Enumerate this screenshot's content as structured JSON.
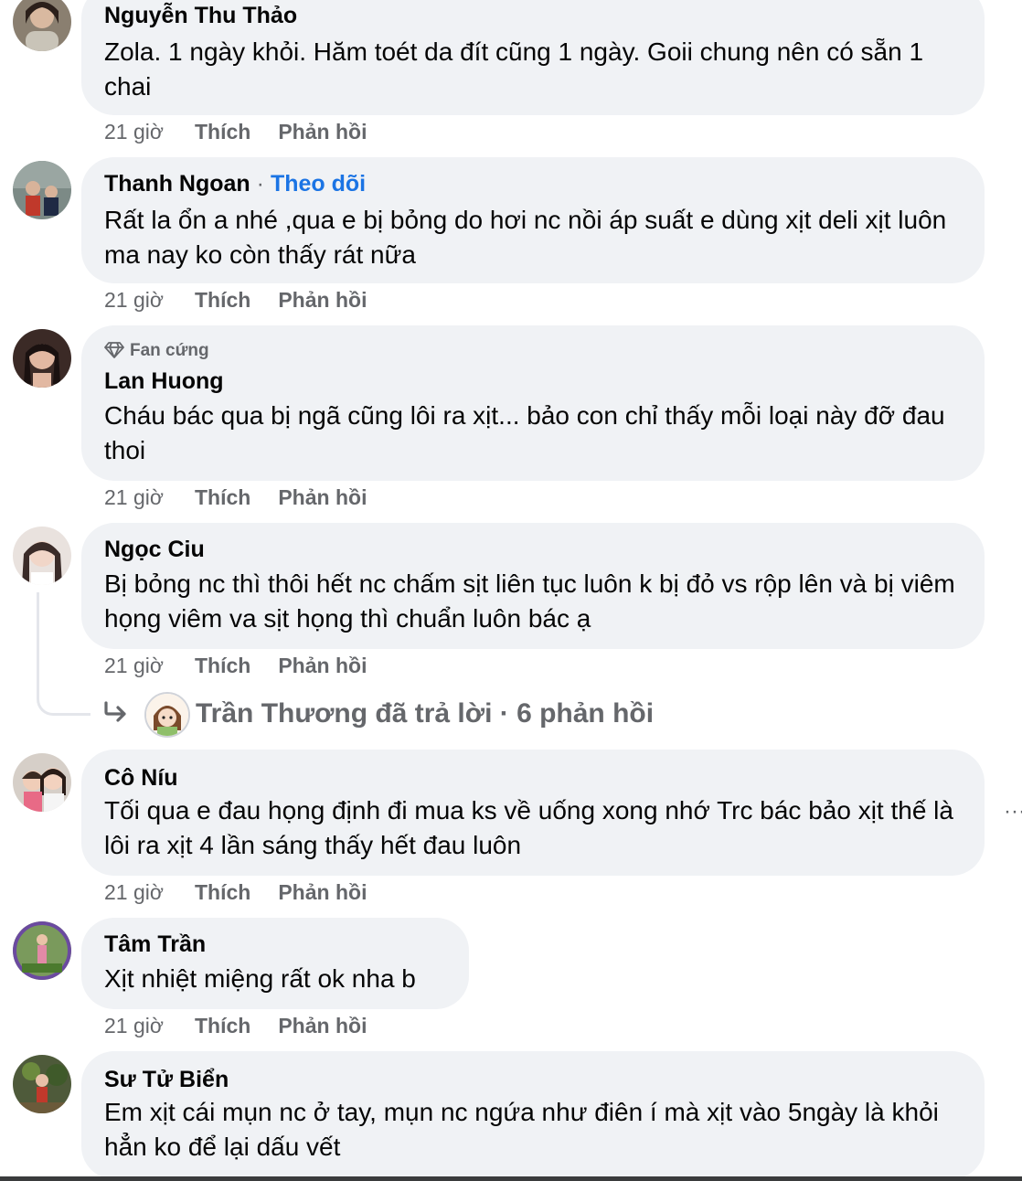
{
  "comments": [
    {
      "author": "Nguyễn Thu Thảo",
      "text": "Zola. 1 ngày khỏi. Hăm toét da đít cũng 1 ngày. Goii chung nên có sẵn 1 chai",
      "time": "21 giờ",
      "like_label": "Thích",
      "reply_label": "Phản hồi"
    },
    {
      "author": "Thanh Ngoan",
      "separator": "·",
      "follow_label": "Theo dõi",
      "text": "Rất la ổn a nhé ,qua e bị bỏng do hơi nc nồi áp suất e dùng xịt deli xịt luôn ma nay ko còn thấy rát nữa",
      "time": "21 giờ",
      "like_label": "Thích",
      "reply_label": "Phản hồi"
    },
    {
      "badge": "Fan cứng",
      "author": "Lan Huong",
      "text": "Cháu bác qua bị ngã cũng lôi ra xịt... bảo con chỉ thấy mỗi loại này đỡ đau thoi",
      "time": "21 giờ",
      "like_label": "Thích",
      "reply_label": "Phản hồi"
    },
    {
      "author": "Ngọc Ciu",
      "text": "Bị bỏng nc thì thôi hết nc chấm sịt liên tục luôn k bị đỏ vs rộp lên và bị viêm họng viêm va sịt họng thì chuẩn luôn bác ạ",
      "time": "21 giờ",
      "like_label": "Thích",
      "reply_label": "Phản hồi",
      "replies_summary": "Trần Thương đã trả lời · 6 phản hồi"
    },
    {
      "author": "Cô Níu",
      "text": "Tối qua e đau họng định đi mua ks về uống xong nhớ Trc bác bảo xịt thế là lôi ra xịt 4 lần sáng thấy hết đau luôn",
      "time": "21 giờ",
      "like_label": "Thích",
      "reply_label": "Phản hồi"
    },
    {
      "author": "Tâm Trần",
      "text": "Xịt nhiệt miệng rất ok nha b",
      "time": "21 giờ",
      "like_label": "Thích",
      "reply_label": "Phản hồi"
    },
    {
      "author": "Sư Tử Biển",
      "text": "Em xịt cái mụn nc ở tay, mụn nc ngứa như điên í mà xịt vào 5ngày là khỏi hẳn ko để lại dấu vết"
    }
  ],
  "icons": {
    "more": "more-options-icon",
    "badge": "diamond-icon",
    "reply": "reply-arrow-icon"
  },
  "colors": {
    "bubble": "#f0f2f5",
    "link": "#1b74e4",
    "secondary_text": "#65676b"
  }
}
